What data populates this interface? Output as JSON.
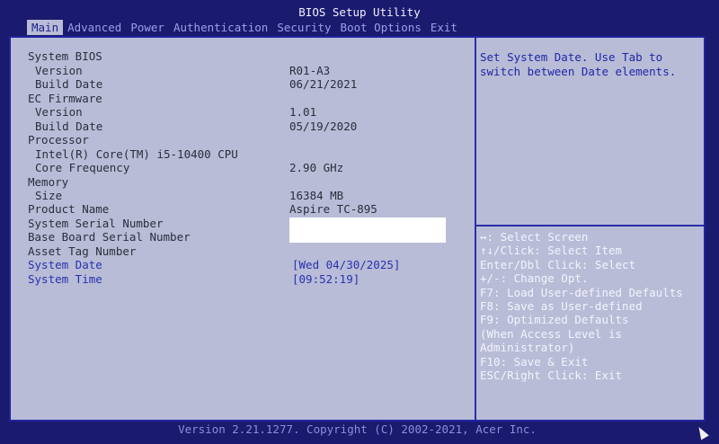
{
  "title": "BIOS Setup Utility",
  "tabs": [
    "Main",
    "Advanced",
    "Power",
    "Authentication",
    "Security",
    "Boot Options",
    "Exit"
  ],
  "main": {
    "system_bios": "System BIOS",
    "version_label": "Version",
    "version_value": "R01-A3",
    "build_date_label": "Build Date",
    "build_date_value": "06/21/2021",
    "ec_firmware": "EC Firmware",
    "ec_version_label": "Version",
    "ec_version_value": "1.01",
    "ec_build_date_label": "Build Date",
    "ec_build_date_value": "05/19/2020",
    "processor": "Processor",
    "cpu_name": "Intel(R) Core(TM) i5-10400 CPU",
    "core_freq_label": "Core Frequency",
    "core_freq_value": "2.90 GHz",
    "memory": "Memory",
    "size_label": "Size",
    "size_value": "16384 MB",
    "product_name_label": "Product Name",
    "product_name_value": "Aspire TC-895",
    "serial_label": "System Serial Number",
    "board_serial_label": "Base Board Serial Number",
    "asset_tag_label": "Asset Tag Number",
    "system_date_label": "System Date",
    "system_date_value": "[Wed 04/30/2025]",
    "system_time_label": "System Time",
    "system_time_value": "[09:52:19]"
  },
  "help_text": "Set System Date. Use Tab to switch between Date elements.",
  "keys": [
    "↔: Select Screen",
    "↑↓/Click: Select Item",
    "Enter/Dbl Click: Select",
    "+/-: Change Opt.",
    "F7: Load User-defined Defaults",
    "F8: Save as User-defined",
    "F9: Optimized Defaults",
    "(When Access Level is",
    "Administrator)",
    "F10: Save & Exit",
    "ESC/Right Click: Exit"
  ],
  "footer": "Version 2.21.1277. Copyright (C) 2002-2021, Acer Inc."
}
